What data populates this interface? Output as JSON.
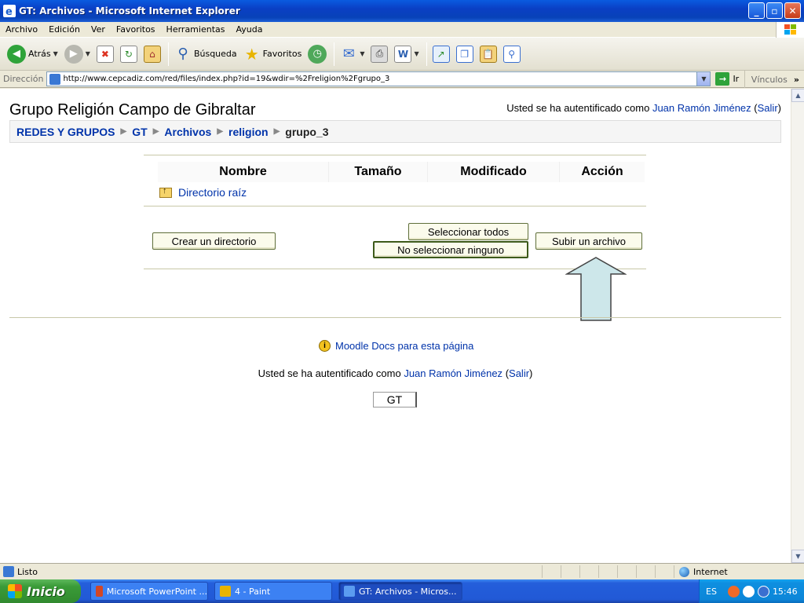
{
  "window": {
    "title": "GT: Archivos - Microsoft Internet Explorer",
    "minimize": "_",
    "maximize": "▫",
    "close": "✕"
  },
  "menu": [
    "Archivo",
    "Edición",
    "Ver",
    "Favoritos",
    "Herramientas",
    "Ayuda"
  ],
  "toolbar": {
    "back": "Atrás",
    "search": "Búsqueda",
    "favorites": "Favoritos"
  },
  "address": {
    "label": "Dirección",
    "url": "http://www.cepcadiz.com/red/files/index.php?id=19&wdir=%2Freligion%2Fgrupo_3",
    "go": "Ir",
    "links": "Vínculos"
  },
  "page": {
    "site_title": "Grupo Religión Campo de Gibraltar",
    "login_prefix": "Usted se ha autentificado como",
    "user_name": "Juan Ramón Jiménez",
    "logout": "Salir",
    "breadcrumb": [
      "REDES Y GRUPOS",
      "GT",
      "Archivos",
      "religion"
    ],
    "breadcrumb_current": "grupo_3",
    "table": {
      "headers": [
        "Nombre",
        "Tamaño",
        "Modificado",
        "Acción"
      ],
      "rows": [
        {
          "name": "Directorio raíz"
        }
      ]
    },
    "buttons": {
      "create_dir": "Crear un directorio",
      "select_all": "Seleccionar todos",
      "select_none": "No seleccionar ninguno",
      "upload": "Subir un archivo"
    },
    "docs_link": "Moodle Docs para esta página",
    "footer_box": "GT"
  },
  "status": {
    "text": "Listo",
    "zone": "Internet"
  },
  "taskbar": {
    "start": "Inicio",
    "items": [
      "Microsoft PowerPoint ...",
      "4 - Paint",
      "GT: Archivos - Micros..."
    ],
    "lang": "ES",
    "clock": "15:46"
  },
  "colors": {
    "link": "#0033aa",
    "arrow_fill": "#cde7ea",
    "button_bg": "#fbfbec"
  }
}
